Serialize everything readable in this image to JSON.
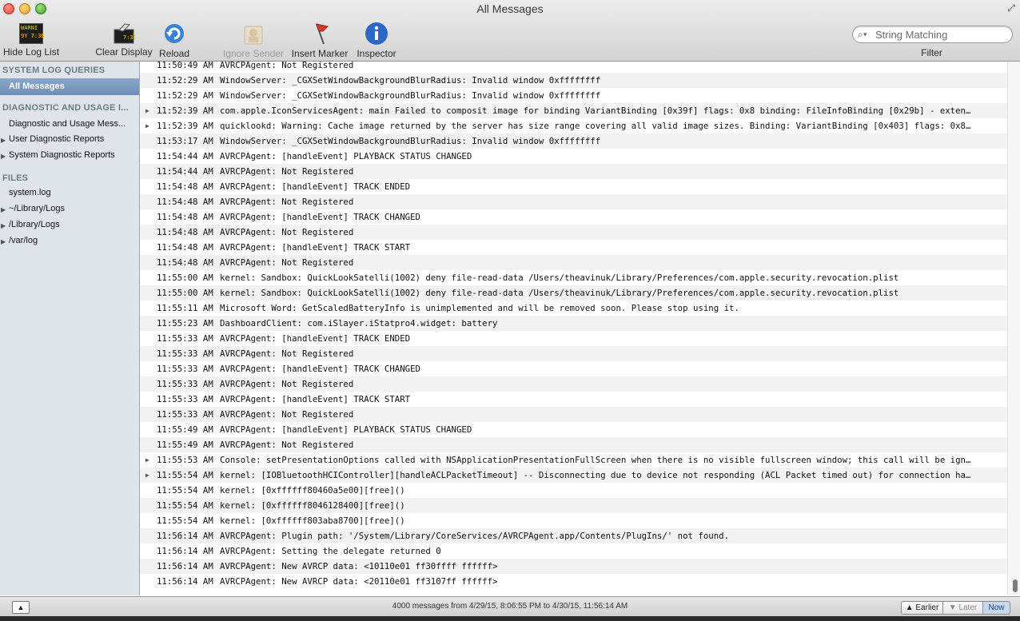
{
  "window": {
    "title": "All Messages"
  },
  "toolbar": {
    "hide_log_list": "Hide Log List",
    "clear_display": "Clear Display",
    "reload": "Reload",
    "ignore_sender": "Ignore Sender",
    "insert_marker": "Insert Marker",
    "inspector": "Inspector",
    "console_icon_text": "WARNI\n9Y 7:36",
    "clear_icon_text": "7:36",
    "search": {
      "placeholder": "String Matching",
      "value": ""
    },
    "filter_label": "Filter"
  },
  "sidebar": {
    "system_log_queries": "SYSTEM LOG QUERIES",
    "all_messages": "All Messages",
    "diagnostic_header": "DIAGNOSTIC AND USAGE I...",
    "diagnostic_messages": "Diagnostic and Usage Mess...",
    "user_reports": "User Diagnostic Reports",
    "system_reports": "System Diagnostic Reports",
    "files_header": "FILES",
    "system_log": "system.log",
    "home_library_logs": "~/Library/Logs",
    "library_logs": "/Library/Logs",
    "var_log": "/var/log"
  },
  "log": [
    {
      "time": "11:50:49 AM",
      "msg": "AVRCPAgent:     Not Registered",
      "expandable": false
    },
    {
      "time": "11:52:29 AM",
      "msg": "WindowServer: _CGXSetWindowBackgroundBlurRadius: Invalid window 0xffffffff",
      "expandable": false
    },
    {
      "time": "11:52:29 AM",
      "msg": "WindowServer: _CGXSetWindowBackgroundBlurRadius: Invalid window 0xffffffff",
      "expandable": false
    },
    {
      "time": "11:52:39 AM",
      "msg": "com.apple.IconServicesAgent: main Failed to composit image for binding VariantBinding [0x39f] flags: 0x8 binding: FileInfoBinding [0x29b] - exten…",
      "expandable": true
    },
    {
      "time": "11:52:39 AM",
      "msg": "quicklookd: Warning: Cache image returned by the server has size range covering all valid image sizes. Binding: VariantBinding [0x403] flags: 0x8…",
      "expandable": true
    },
    {
      "time": "11:53:17 AM",
      "msg": "WindowServer: _CGXSetWindowBackgroundBlurRadius: Invalid window 0xffffffff",
      "expandable": false
    },
    {
      "time": "11:54:44 AM",
      "msg": "AVRCPAgent: [handleEvent] PLAYBACK STATUS CHANGED",
      "expandable": false
    },
    {
      "time": "11:54:44 AM",
      "msg": "AVRCPAgent:     Not Registered",
      "expandable": false
    },
    {
      "time": "11:54:48 AM",
      "msg": "AVRCPAgent: [handleEvent] TRACK ENDED",
      "expandable": false
    },
    {
      "time": "11:54:48 AM",
      "msg": "AVRCPAgent:     Not Registered",
      "expandable": false
    },
    {
      "time": "11:54:48 AM",
      "msg": "AVRCPAgent: [handleEvent] TRACK CHANGED",
      "expandable": false
    },
    {
      "time": "11:54:48 AM",
      "msg": "AVRCPAgent:     Not Registered",
      "expandable": false
    },
    {
      "time": "11:54:48 AM",
      "msg": "AVRCPAgent: [handleEvent] TRACK START",
      "expandable": false
    },
    {
      "time": "11:54:48 AM",
      "msg": "AVRCPAgent:     Not Registered",
      "expandable": false
    },
    {
      "time": "11:55:00 AM",
      "msg": "kernel: Sandbox: QuickLookSatelli(1002) deny file-read-data /Users/theavinuk/Library/Preferences/com.apple.security.revocation.plist",
      "expandable": false
    },
    {
      "time": "11:55:00 AM",
      "msg": "kernel: Sandbox: QuickLookSatelli(1002) deny file-read-data /Users/theavinuk/Library/Preferences/com.apple.security.revocation.plist",
      "expandable": false
    },
    {
      "time": "11:55:11 AM",
      "msg": "Microsoft Word: GetScaledBatteryInfo is unimplemented and will be removed soon.  Please stop using it.",
      "expandable": false
    },
    {
      "time": "11:55:23 AM",
      "msg": "DashboardClient: com.iSlayer.iStatpro4.widget: battery",
      "expandable": false
    },
    {
      "time": "11:55:33 AM",
      "msg": "AVRCPAgent: [handleEvent] TRACK ENDED",
      "expandable": false
    },
    {
      "time": "11:55:33 AM",
      "msg": "AVRCPAgent:     Not Registered",
      "expandable": false
    },
    {
      "time": "11:55:33 AM",
      "msg": "AVRCPAgent: [handleEvent] TRACK CHANGED",
      "expandable": false
    },
    {
      "time": "11:55:33 AM",
      "msg": "AVRCPAgent:     Not Registered",
      "expandable": false
    },
    {
      "time": "11:55:33 AM",
      "msg": "AVRCPAgent: [handleEvent] TRACK START",
      "expandable": false
    },
    {
      "time": "11:55:33 AM",
      "msg": "AVRCPAgent:     Not Registered",
      "expandable": false
    },
    {
      "time": "11:55:49 AM",
      "msg": "AVRCPAgent: [handleEvent] PLAYBACK STATUS CHANGED",
      "expandable": false
    },
    {
      "time": "11:55:49 AM",
      "msg": "AVRCPAgent:     Not Registered",
      "expandable": false
    },
    {
      "time": "11:55:53 AM",
      "msg": "Console: setPresentationOptions called with NSApplicationPresentationFullScreen when there is no visible fullscreen window; this call will be ign…",
      "expandable": true
    },
    {
      "time": "11:55:54 AM",
      "msg": "kernel: [IOBluetoothHCIController][handleACLPacketTimeout] -- Disconnecting due to device not responding (ACL Packet timed out) for connection ha…",
      "expandable": true
    },
    {
      "time": "11:55:54 AM",
      "msg": "kernel: [0xffffff80460a5e00][free]()",
      "expandable": false
    },
    {
      "time": "11:55:54 AM",
      "msg": "kernel: [0xffffff8046128400][free]()",
      "expandable": false
    },
    {
      "time": "11:55:54 AM",
      "msg": "kernel: [0xffffff803aba8700][free]()",
      "expandable": false
    },
    {
      "time": "11:56:14 AM",
      "msg": "AVRCPAgent: Plugin path: '/System/Library/CoreServices/AVRCPAgent.app/Contents/PlugIns/' not found.",
      "expandable": false
    },
    {
      "time": "11:56:14 AM",
      "msg": "AVRCPAgent: Setting the delegate returned 0",
      "expandable": false
    },
    {
      "time": "11:56:14 AM",
      "msg": "AVRCPAgent: New AVRCP data: <10110e01 ff30ffff ffffff>",
      "expandable": false
    },
    {
      "time": "11:56:14 AM",
      "msg": "AVRCPAgent: New AVRCP data: <20110e01 ff3107ff ffffff>",
      "expandable": false
    }
  ],
  "bottombar": {
    "status": "4000 messages from 4/29/15, 8:06:55 PM to 4/30/15, 11:56:14 AM",
    "earlier": "Earlier",
    "later": "Later",
    "now": "Now"
  }
}
